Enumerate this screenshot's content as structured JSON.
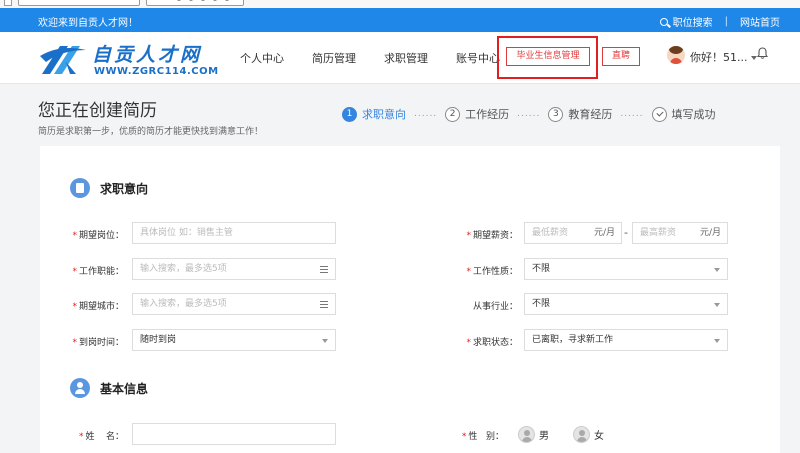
{
  "topbar": {
    "welcome": "欢迎来到自贡人才网！",
    "job_search": "职位搜索",
    "separator": "|",
    "home": "网站首页"
  },
  "header": {
    "logo_cn": "自贡人才网",
    "logo_en": "WWW.ZGRC114.COM",
    "nav": [
      "个人中心",
      "简历管理",
      "求职管理",
      "账号中心"
    ],
    "graduate_btn": "毕业生信息管理",
    "zhipin_btn": "直聘",
    "greeting": "你好！51...",
    "accent": "#1e87e8",
    "highlight": "#e02020"
  },
  "page": {
    "title": "您正在创建简历",
    "subtitle": "简历是求职第一步，优质的简历才能更快找到满意工作！",
    "steps": [
      {
        "num": "1",
        "label": "求职意向"
      },
      {
        "num": "2",
        "label": "工作经历"
      },
      {
        "num": "3",
        "label": "教育经历"
      },
      {
        "num": "",
        "label": "填写成功"
      }
    ],
    "step_dots": "......"
  },
  "intent": {
    "title": "求职意向",
    "position": {
      "label": "期望岗位：",
      "placeholder": "具体岗位 如：销售主管"
    },
    "salary": {
      "label": "期望薪资：",
      "min_placeholder": "最低薪资",
      "max_placeholder": "最高薪资",
      "unit": "元/月",
      "dash": "-"
    },
    "function": {
      "label": "工作职能：",
      "placeholder": "输入搜索，最多选5项"
    },
    "nature": {
      "label": "工作性质：",
      "value": "不限"
    },
    "city": {
      "label": "期望城市：",
      "placeholder": "输入搜索，最多选5项"
    },
    "industry": {
      "label": "从事行业：",
      "value": "不限"
    },
    "arrival": {
      "label": "到岗时间：",
      "value": "随时到岗"
    },
    "status": {
      "label": "求职状态：",
      "value": "已离职，寻求新工作"
    }
  },
  "basic": {
    "title": "基本信息",
    "name": {
      "label_1": "姓",
      "label_2": "名："
    },
    "gender": {
      "label_1": "性",
      "label_2": "别：",
      "male": "男",
      "female": "女"
    }
  }
}
